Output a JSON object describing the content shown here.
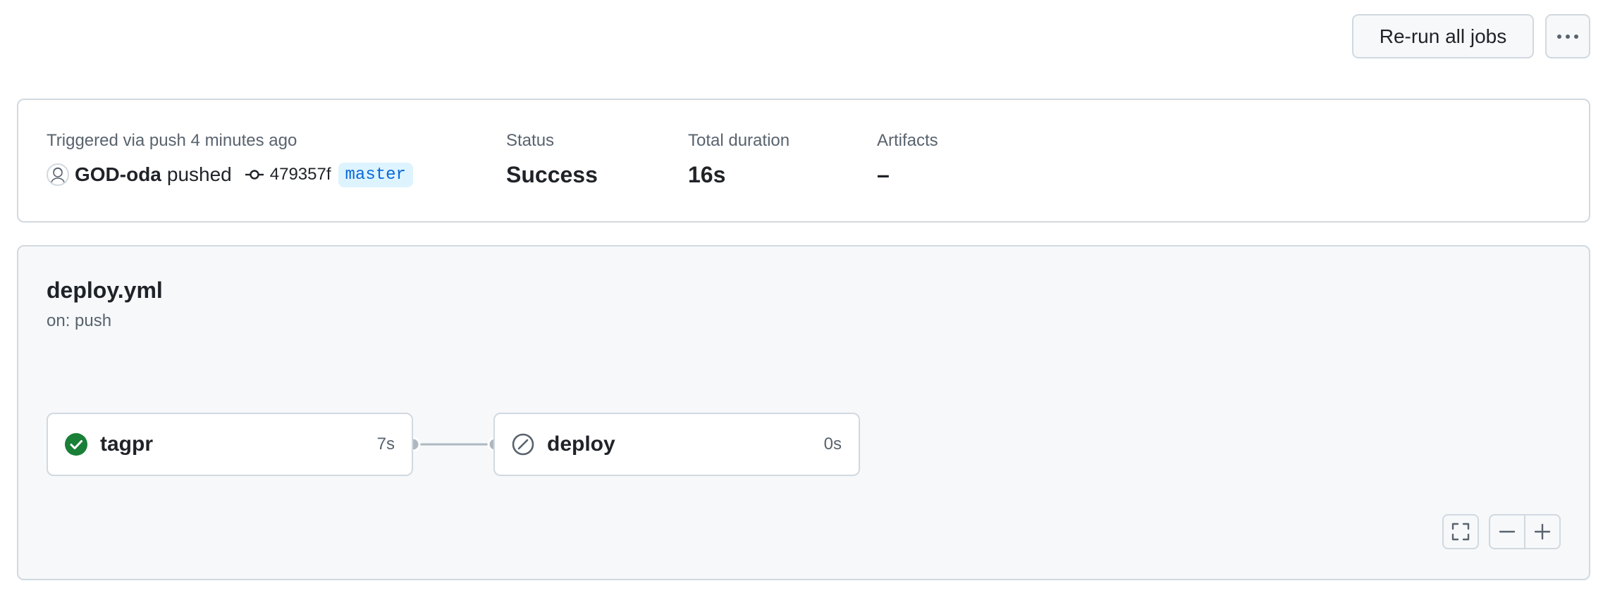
{
  "header": {
    "rerun_label": "Re-run all jobs",
    "more_icon": "kebab-horizontal-icon"
  },
  "summary": {
    "trigger_text": "Triggered via push 4 minutes ago",
    "actor": "GOD-oda",
    "action": "pushed",
    "commit_sha": "479357f",
    "branch": "master",
    "status_label": "Status",
    "status_value": "Success",
    "duration_label": "Total duration",
    "duration_value": "16s",
    "artifacts_label": "Artifacts",
    "artifacts_value": "–"
  },
  "workflow": {
    "file": "deploy.yml",
    "trigger": "on: push",
    "jobs": [
      {
        "name": "tagpr",
        "duration": "7s",
        "status": "success",
        "icon": "check-circle-fill-icon"
      },
      {
        "name": "deploy",
        "duration": "0s",
        "status": "skipped",
        "icon": "skip-icon"
      }
    ]
  },
  "colors": {
    "success": "#1a7f37",
    "skipped": "#59636e",
    "branch_bg": "#ddf4ff",
    "branch_fg": "#0969da",
    "border": "#d1d9e0"
  }
}
